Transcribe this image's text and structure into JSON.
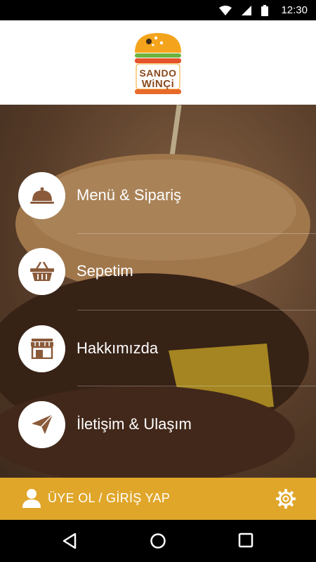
{
  "status_bar": {
    "time": "12:30"
  },
  "logo": {
    "line1": "SANDO",
    "line2": "WiNÇi"
  },
  "menu": {
    "items": [
      {
        "label": "Menü & Sipariş",
        "icon": "cloche-icon"
      },
      {
        "label": "Sepetim",
        "icon": "basket-icon"
      },
      {
        "label": "Hakkımızda",
        "icon": "storefront-icon"
      },
      {
        "label": "İletişim & Ulaşım",
        "icon": "paper-plane-icon"
      }
    ]
  },
  "bottom_bar": {
    "login_label": "ÜYE OL / GİRİŞ YAP",
    "user_icon": "user-icon",
    "settings_icon": "gear-icon"
  },
  "nav": {
    "back_icon": "back-icon",
    "home_icon": "home-icon",
    "recents_icon": "recents-icon"
  },
  "colors": {
    "accent": "#e0a62a",
    "logo_brown": "#8a4a1c",
    "logo_orange": "#f4a41c",
    "logo_green": "#6db33f",
    "icon_brown": "#8a5a3a"
  }
}
